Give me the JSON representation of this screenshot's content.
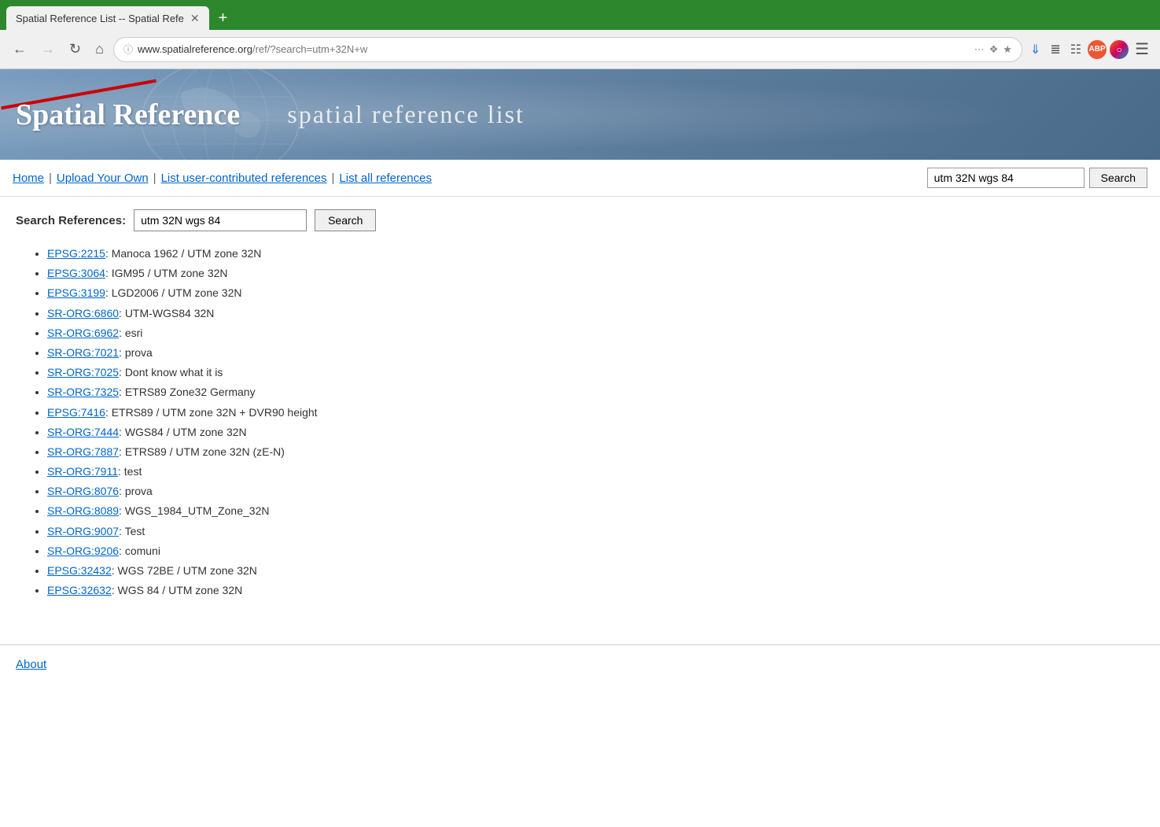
{
  "browser": {
    "tab_title": "Spatial Reference List -- Spatial Refe",
    "url_display": "www.spatialreference.org/ref/?search=utm+32N+w",
    "url_domain": "www.spatialreference.org",
    "url_path": "/ref/?search=utm+32N+w"
  },
  "header": {
    "site_title": "Spatial Reference",
    "page_subtitle": "spatial reference list"
  },
  "nav": {
    "home_label": "Home",
    "upload_label": "Upload Your Own",
    "user_contributed_label": "List user-contributed references",
    "list_all_label": "List all references",
    "search_placeholder": "utm 32N wgs 84",
    "search_value": "utm 32N wgs 84",
    "search_button": "Search"
  },
  "search_section": {
    "label": "Search References:",
    "input_value": "utm 32N wgs 84",
    "button_label": "Search"
  },
  "results": [
    {
      "code": "EPSG:2215",
      "description": "Manoca 1962 / UTM zone 32N",
      "href": "#"
    },
    {
      "code": "EPSG:3064",
      "description": "IGM95 / UTM zone 32N",
      "href": "#"
    },
    {
      "code": "EPSG:3199",
      "description": "LGD2006 / UTM zone 32N",
      "href": "#"
    },
    {
      "code": "SR-ORG:6860",
      "description": "UTM-WGS84 32N",
      "href": "#"
    },
    {
      "code": "SR-ORG:6962",
      "description": "esri",
      "href": "#"
    },
    {
      "code": "SR-ORG:7021",
      "description": "prova",
      "href": "#"
    },
    {
      "code": "SR-ORG:7025",
      "description": "Dont know what it is",
      "href": "#"
    },
    {
      "code": "SR-ORG:7325",
      "description": "ETRS89 Zone32 Germany",
      "href": "#"
    },
    {
      "code": "EPSG:7416",
      "description": "ETRS89 / UTM zone 32N + DVR90 height",
      "href": "#"
    },
    {
      "code": "SR-ORG:7444",
      "description": "WGS84 / UTM zone 32N",
      "href": "#"
    },
    {
      "code": "SR-ORG:7887",
      "description": "ETRS89 / UTM zone 32N (zE-N)",
      "href": "#"
    },
    {
      "code": "SR-ORG:7911",
      "description": "test",
      "href": "#"
    },
    {
      "code": "SR-ORG:8076",
      "description": "prova",
      "href": "#"
    },
    {
      "code": "SR-ORG:8089",
      "description": "WGS_1984_UTM_Zone_32N",
      "href": "#"
    },
    {
      "code": "SR-ORG:9007",
      "description": "Test",
      "href": "#"
    },
    {
      "code": "SR-ORG:9206",
      "description": "comuni",
      "href": "#"
    },
    {
      "code": "EPSG:32432",
      "description": "WGS 72BE / UTM zone 32N",
      "href": "#"
    },
    {
      "code": "EPSG:32632",
      "description": "WGS 84 / UTM zone 32N",
      "href": "#"
    }
  ],
  "footer": {
    "about_label": "About"
  }
}
